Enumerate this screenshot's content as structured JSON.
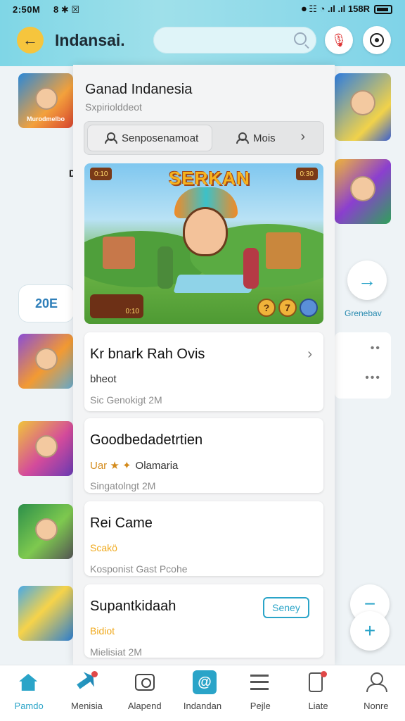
{
  "status_bar": {
    "time": "2:50M",
    "left_icons": "8 ✱ ☒",
    "right_text": "⏺ ☷ ◔ .ıl .ıl 158R"
  },
  "header": {
    "title": "Indansai.",
    "search_placeholder": ""
  },
  "background": {
    "left_thumb_caption": "Murodmelbo",
    "count_pill": "20E",
    "stray_letter": "D",
    "right_caption": "Grenebav"
  },
  "sheet": {
    "title": "Ganad Indanesia",
    "subtitle": "Sxpiriolddeot",
    "tab_primary": "Senposenamoat",
    "tab_secondary": "Mois",
    "banner": {
      "title": "SERKAN",
      "badge_tl": "0:10",
      "badge_tr": "0:30",
      "badge_bl": "0:10",
      "coin_1": "?",
      "coin_2": "7"
    },
    "cards": [
      {
        "title": "Kr bnark Rah Ovis",
        "subtitle": "bheot",
        "meta": "Sic Genokigt 2M"
      },
      {
        "title": "Goodbedadetrtien",
        "subtitle": "Olamaria",
        "subtitle_prefix": "Uar ★ ✦",
        "meta": "Singatolngt 2M"
      },
      {
        "title": "Rei Came",
        "subtitle": "Scakö",
        "meta": "Kosponist Gast Pcohe"
      },
      {
        "title": "Supantkidaah",
        "subtitle": "Bidiot",
        "meta": "Mielisiat 2M",
        "button": "Seney"
      }
    ]
  },
  "bottom_nav": [
    {
      "label": "Pamdo"
    },
    {
      "label": "Menisia"
    },
    {
      "label": "Alapend"
    },
    {
      "label": "Indandan"
    },
    {
      "label": "Pejle"
    },
    {
      "label": "Liate"
    },
    {
      "label": "Nonre"
    }
  ],
  "colors": {
    "accent": "#2aa4c8",
    "header_gradient": "#7fd6e6",
    "back_button": "#f6c53d",
    "notification_dot": "#e04848"
  }
}
